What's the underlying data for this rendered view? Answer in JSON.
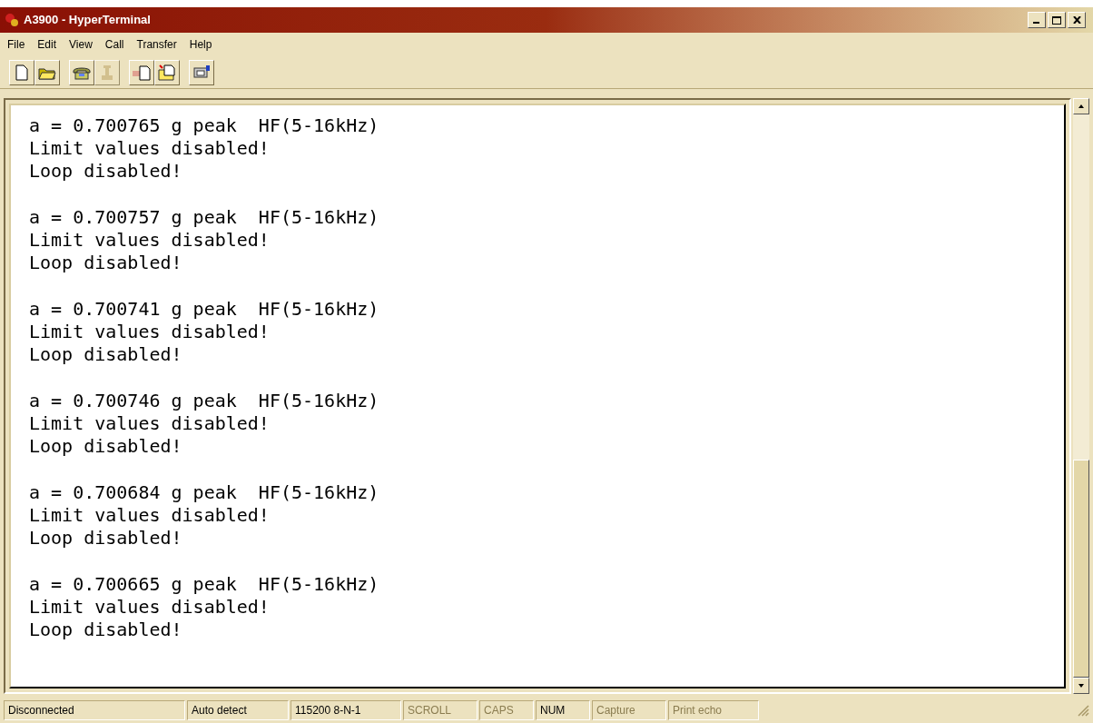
{
  "window": {
    "title": "A3900 - HyperTerminal"
  },
  "menu": [
    "File",
    "Edit",
    "View",
    "Call",
    "Transfer",
    "Help"
  ],
  "toolbar": [
    [
      {
        "kind": "new",
        "disabled": false
      },
      {
        "kind": "open",
        "disabled": false
      }
    ],
    [
      {
        "kind": "connect",
        "disabled": false
      },
      {
        "kind": "disconnect",
        "disabled": true
      }
    ],
    [
      {
        "kind": "send",
        "disabled": false
      },
      {
        "kind": "receive",
        "disabled": false
      }
    ],
    [
      {
        "kind": "properties",
        "disabled": false
      }
    ]
  ],
  "terminal": [
    {
      "lines": [
        "a = 0.700765 g peak  HF(5-16kHz)",
        "Limit values disabled!",
        "Loop disabled!"
      ]
    },
    {
      "lines": [
        "a = 0.700757 g peak  HF(5-16kHz)",
        "Limit values disabled!",
        "Loop disabled!"
      ]
    },
    {
      "lines": [
        "a = 0.700741 g peak  HF(5-16kHz)",
        "Limit values disabled!",
        "Loop disabled!"
      ]
    },
    {
      "lines": [
        "a = 0.700746 g peak  HF(5-16kHz)",
        "Limit values disabled!",
        "Loop disabled!"
      ]
    },
    {
      "lines": [
        "a = 0.700684 g peak  HF(5-16kHz)",
        "Limit values disabled!",
        "Loop disabled!"
      ]
    },
    {
      "lines": [
        "a = 0.700665 g peak  HF(5-16kHz)",
        "Limit values disabled!",
        "Loop disabled!"
      ]
    }
  ],
  "status_bar": [
    {
      "text": "Disconnected",
      "disabled": false
    },
    {
      "text": "Auto detect",
      "disabled": false
    },
    {
      "text": "115200 8-N-1",
      "disabled": false
    },
    {
      "text": "SCROLL",
      "disabled": true
    },
    {
      "text": "CAPS",
      "disabled": true
    },
    {
      "text": "NUM",
      "disabled": false
    },
    {
      "text": "Capture",
      "disabled": true
    },
    {
      "text": "Print echo",
      "disabled": true
    }
  ]
}
